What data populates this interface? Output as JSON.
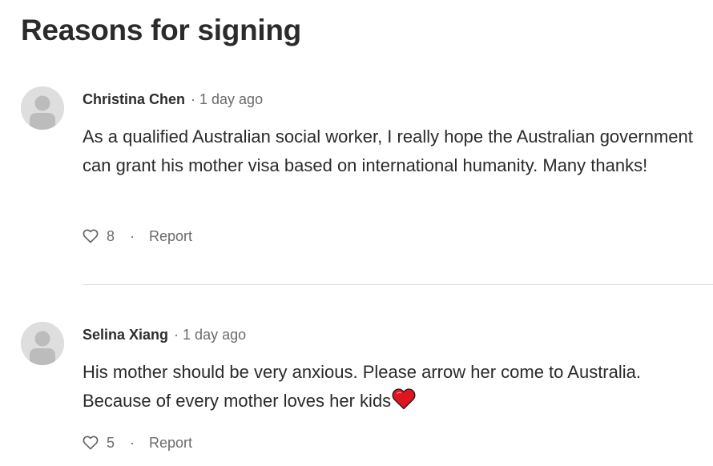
{
  "section": {
    "title": "Reasons for signing"
  },
  "comments": [
    {
      "author": "Christina Chen",
      "separator": "·",
      "time": "1 day ago",
      "body": "As a qualified Australian social worker, I really hope the Australian government can grant his mother visa based on international humanity. Many thanks!",
      "likes": "8",
      "action_separator": "·",
      "report_label": "Report",
      "avatar_icon": "default-user-avatar",
      "like_icon": "heart-outline-icon"
    },
    {
      "author": "Selina Xiang",
      "separator": "·",
      "time": "1 day ago",
      "body": "His mother should be very anxious. Please arrow her come to Australia. Because of every mother loves her kids",
      "emoji": "red-heart-emoji",
      "likes": "5",
      "action_separator": "·",
      "report_label": "Report",
      "avatar_icon": "default-user-avatar",
      "like_icon": "heart-outline-icon"
    }
  ],
  "colors": {
    "text_primary": "#2a2a2a",
    "text_secondary": "#6b6b6b",
    "avatar_bg": "#dedede",
    "avatar_fg": "#bcbcbc",
    "divider": "#dcdcdc",
    "emoji_heart": "#e0141e"
  }
}
